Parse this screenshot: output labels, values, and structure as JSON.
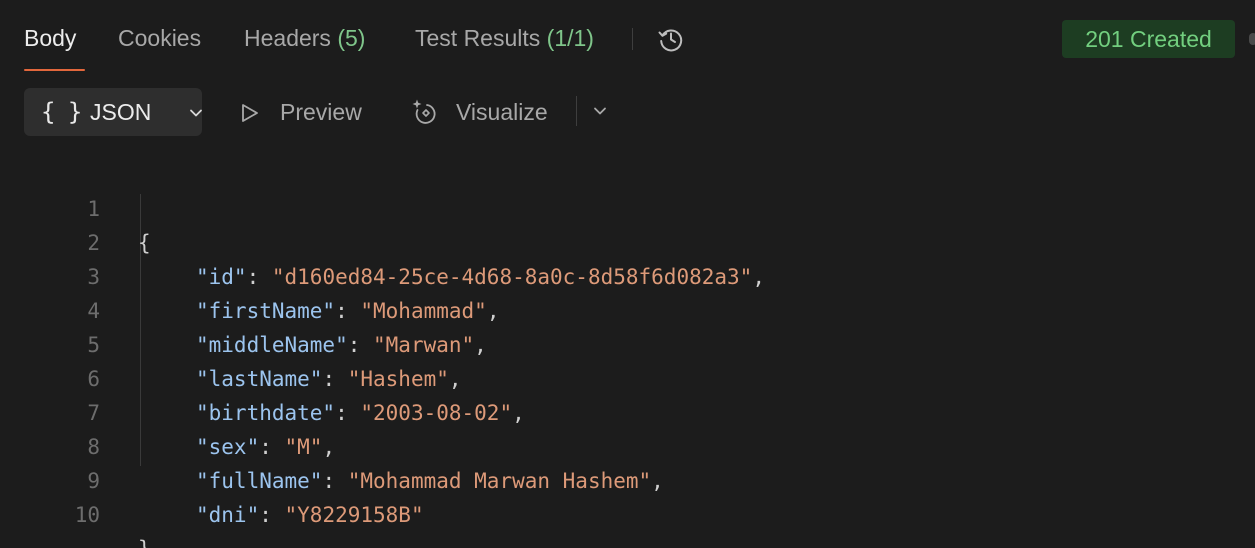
{
  "tabs": [
    {
      "label": "Body",
      "count": ""
    },
    {
      "label": "Cookies",
      "count": ""
    },
    {
      "label": "Headers ",
      "count": "(5)"
    },
    {
      "label": "Test Results ",
      "count": "(1/1)"
    }
  ],
  "history_icon": "history-clock-icon",
  "status": {
    "text": "201 Created",
    "color": "#72cf7f"
  },
  "toolbar": {
    "format_braces": "{ }",
    "format_label": "JSON",
    "preview_label": "Preview",
    "visualize_label": "Visualize"
  },
  "colors": {
    "accent": "#e2673c",
    "key": "#9cc4ee",
    "string": "#dd9a79",
    "count": "#7fc58a"
  },
  "code": {
    "open": "{",
    "close": "}",
    "lines": [
      {
        "num": "1"
      },
      {
        "num": "2",
        "key": "\"id\"",
        "value": "\"d160ed84-25ce-4d68-8a0c-8d58f6d082a3\"",
        "comma": ","
      },
      {
        "num": "3",
        "key": "\"firstName\"",
        "value": "\"Mohammad\"",
        "comma": ","
      },
      {
        "num": "4",
        "key": "\"middleName\"",
        "value": "\"Marwan\"",
        "comma": ","
      },
      {
        "num": "5",
        "key": "\"lastName\"",
        "value": "\"Hashem\"",
        "comma": ","
      },
      {
        "num": "6",
        "key": "\"birthdate\"",
        "value": "\"2003-08-02\"",
        "comma": ","
      },
      {
        "num": "7",
        "key": "\"sex\"",
        "value": "\"M\"",
        "comma": ","
      },
      {
        "num": "8",
        "key": "\"fullName\"",
        "value": "\"Mohammad Marwan Hashem\"",
        "comma": ","
      },
      {
        "num": "9",
        "key": "\"dni\"",
        "value": "\"Y8229158B\"",
        "comma": ""
      },
      {
        "num": "10"
      }
    ]
  }
}
